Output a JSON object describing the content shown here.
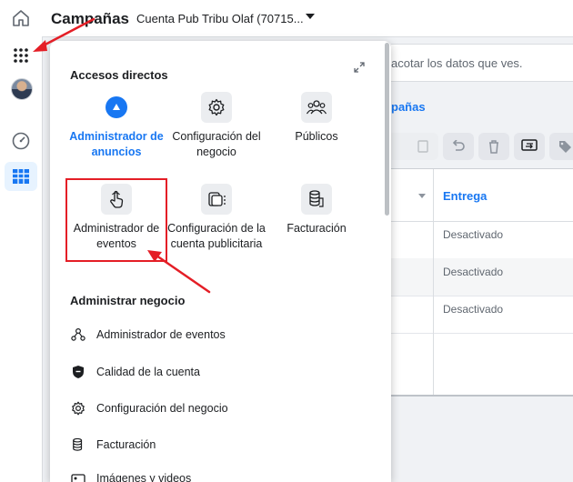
{
  "header": {
    "title": "Campañas",
    "account": "Cuenta Pub Tribu Olaf (70715..."
  },
  "rail": {
    "icons": [
      "home-icon",
      "apps-grid-icon",
      "avatar",
      "gauge-icon",
      "table-grid-icon"
    ]
  },
  "background": {
    "hint": "acotar los datos que ves.",
    "tab_label": "pañas",
    "table": {
      "column_header": "Entrega",
      "rows": [
        "Desactivado",
        "Desactivado",
        "Desactivado"
      ]
    }
  },
  "menu": {
    "shortcuts_title": "Accesos directos",
    "tiles": [
      {
        "label": "Administrador de anuncios",
        "icon": "ads-manager-icon",
        "selected": true
      },
      {
        "label": "Configuración del negocio",
        "icon": "gear-icon",
        "selected": false
      },
      {
        "label": "Públicos",
        "icon": "audiences-icon",
        "selected": false
      },
      {
        "label": "Administrador de eventos",
        "icon": "events-manager-icon",
        "selected": false
      },
      {
        "label": "Configuración de la cuenta publicitaria",
        "icon": "ad-account-settings-icon",
        "selected": false
      },
      {
        "label": "Facturación",
        "icon": "billing-icon",
        "selected": false
      }
    ],
    "manage_title": "Administrar negocio",
    "list": [
      {
        "label": "Administrador de eventos",
        "icon": "events-icon"
      },
      {
        "label": "Calidad de la cuenta",
        "icon": "shield-icon"
      },
      {
        "label": "Configuración del negocio",
        "icon": "gear-icon"
      },
      {
        "label": "Facturación",
        "icon": "billing-icon"
      },
      {
        "label": "Imágenes y videos",
        "icon": "image-icon"
      }
    ]
  },
  "colors": {
    "accent": "#1877f2",
    "annotation": "#e41e26"
  }
}
